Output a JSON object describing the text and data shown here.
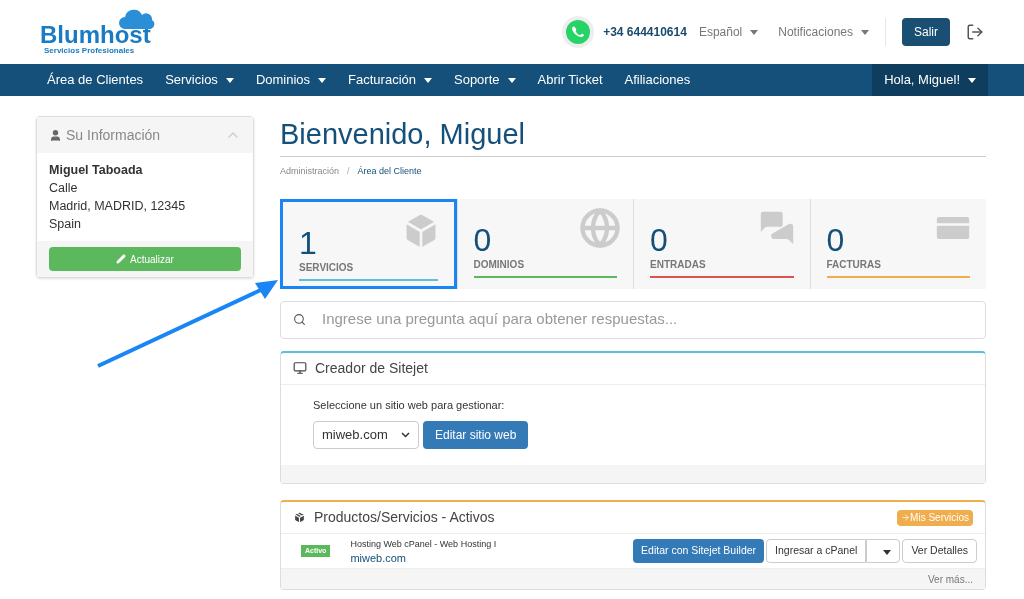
{
  "header": {
    "logo": {
      "name": "Blumhost",
      "tagline": "Servicios Profesionales"
    },
    "phone": "+34 644410614",
    "language": "Español",
    "notifications": "Notificaciones",
    "logout_button": "Salir"
  },
  "nav": {
    "items": [
      {
        "label": "Área de Clientes",
        "dropdown": false
      },
      {
        "label": "Servicios",
        "dropdown": true
      },
      {
        "label": "Dominios",
        "dropdown": true
      },
      {
        "label": "Facturación",
        "dropdown": true
      },
      {
        "label": "Soporte",
        "dropdown": true
      },
      {
        "label": "Abrir Ticket",
        "dropdown": false
      },
      {
        "label": "Afiliaciones",
        "dropdown": false
      }
    ],
    "user_menu": "Hola, Miguel!"
  },
  "sidebar": {
    "title": "Su Información",
    "name": "Miguel Taboada",
    "address": [
      "Calle",
      "Madrid, MADRID, 12345",
      "Spain"
    ],
    "update_button": "Actualizar"
  },
  "page": {
    "title": "Bienvenido, Miguel",
    "breadcrumb": [
      "Administración",
      "Área del Cliente"
    ],
    "breadcrumb_separator": "/"
  },
  "stats": [
    {
      "kind": "box",
      "count": "1",
      "label": "SERVICIOS",
      "color": "#5bc0de",
      "highlighted": true
    },
    {
      "kind": "globe",
      "count": "0",
      "label": "DOMINIOS",
      "color": "#5cb85c",
      "highlighted": false
    },
    {
      "kind": "chat",
      "count": "0",
      "label": "ENTRADAS",
      "color": "#d9534f",
      "highlighted": false
    },
    {
      "kind": "card",
      "count": "0",
      "label": "FACTURAS",
      "color": "#f0ad4e",
      "highlighted": false
    }
  ],
  "search": {
    "placeholder": "Ingrese una pregunta aquí para obtener respuestas..."
  },
  "sitejet": {
    "title": "Creador de Sitejet",
    "prompt": "Seleccione un sitio web para gestionar:",
    "site": "miweb.com",
    "button": "Editar sitio web"
  },
  "products": {
    "title": "Productos/Servicios - Activos",
    "link": "Mis Servicios",
    "rows": [
      {
        "status": "Activo",
        "product": "Hosting Web cPanel - Web Hosting I",
        "domain": "miweb.com",
        "actions": [
          "Editar con Sitejet Builder",
          "Ingresar a cPanel",
          "Ver Detalles"
        ]
      }
    ],
    "more": "Ver más..."
  }
}
